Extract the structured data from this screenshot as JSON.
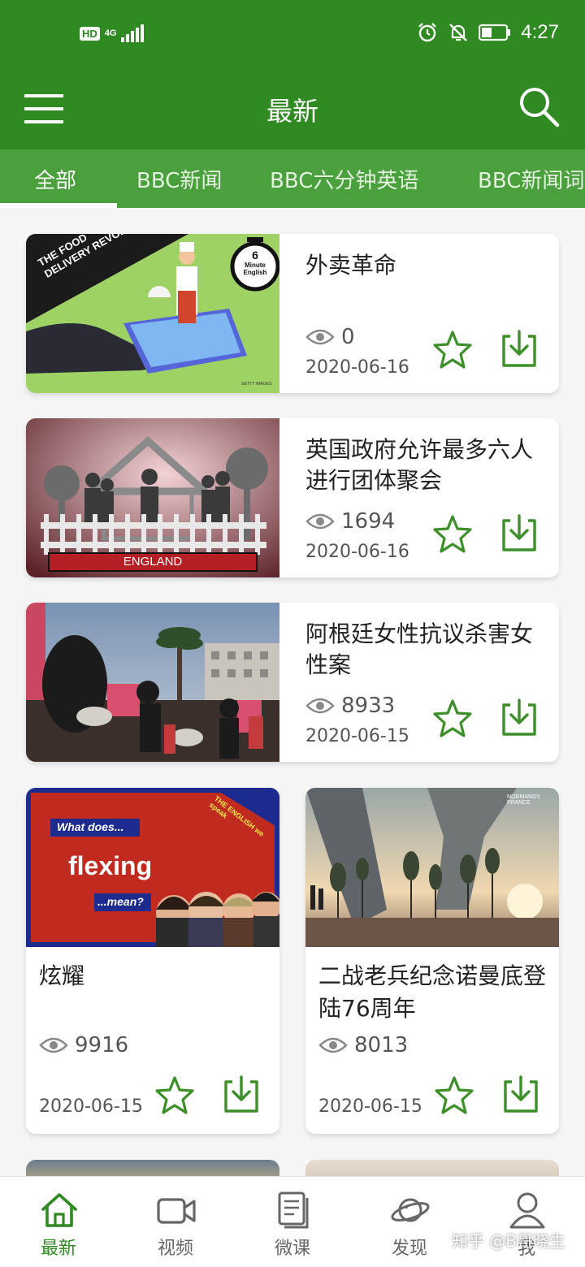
{
  "status_bar": {
    "hd_label": "HD",
    "network_label": "4G",
    "time": "4:27",
    "icons": [
      "signal-icon",
      "alarm-icon",
      "mute-icon",
      "battery-icon"
    ]
  },
  "header": {
    "title": "最新",
    "menu_icon": "menu-icon",
    "search_icon": "search-icon"
  },
  "tabs": [
    {
      "label": "全部",
      "active": true
    },
    {
      "label": "BBC新闻"
    },
    {
      "label": "BBC六分钟英语"
    },
    {
      "label": "BBC新闻词"
    }
  ],
  "thumbnail_text": {
    "food_banner": "THE FOOD\nDELIVERY REVOLUTION",
    "six_minute": "6",
    "minute_english": "Minute\nEnglish",
    "getty": "GETTY IMAGES",
    "england": "ENGLAND",
    "what_does": "What does...",
    "flexing": "flexing",
    "mean": "...mean?",
    "the_english_we_speak": "THE ENGLISH we speak",
    "normandy": "NORMANDY, FRANCE"
  },
  "articles_wide": [
    {
      "title": "外卖革命",
      "views": "0",
      "date": "2020-06-16"
    },
    {
      "title": "英国政府允许最多六人进行团体聚会",
      "views": "1694",
      "date": "2020-06-16"
    },
    {
      "title": "阿根廷女性抗议杀害女性案",
      "views": "8933",
      "date": "2020-06-15"
    }
  ],
  "articles_grid": [
    {
      "title": "炫耀",
      "views": "9916",
      "date": "2020-06-15"
    },
    {
      "title": "二战老兵纪念诺曼底登陆76周年",
      "views": "8013",
      "date": "2020-06-15"
    }
  ],
  "bottom_nav": [
    {
      "label": "最新",
      "icon": "home-icon",
      "active": true
    },
    {
      "label": "视频",
      "icon": "video-icon"
    },
    {
      "label": "微课",
      "icon": "book-icon"
    },
    {
      "label": "发现",
      "icon": "planet-icon"
    },
    {
      "label": "我",
      "icon": "user-icon"
    }
  ],
  "watermark": "知乎 @B哥晓生",
  "colors": {
    "primary": "#2f8a22",
    "tab_bar": "#4aa03c",
    "icon_green": "#3d8f2a"
  }
}
